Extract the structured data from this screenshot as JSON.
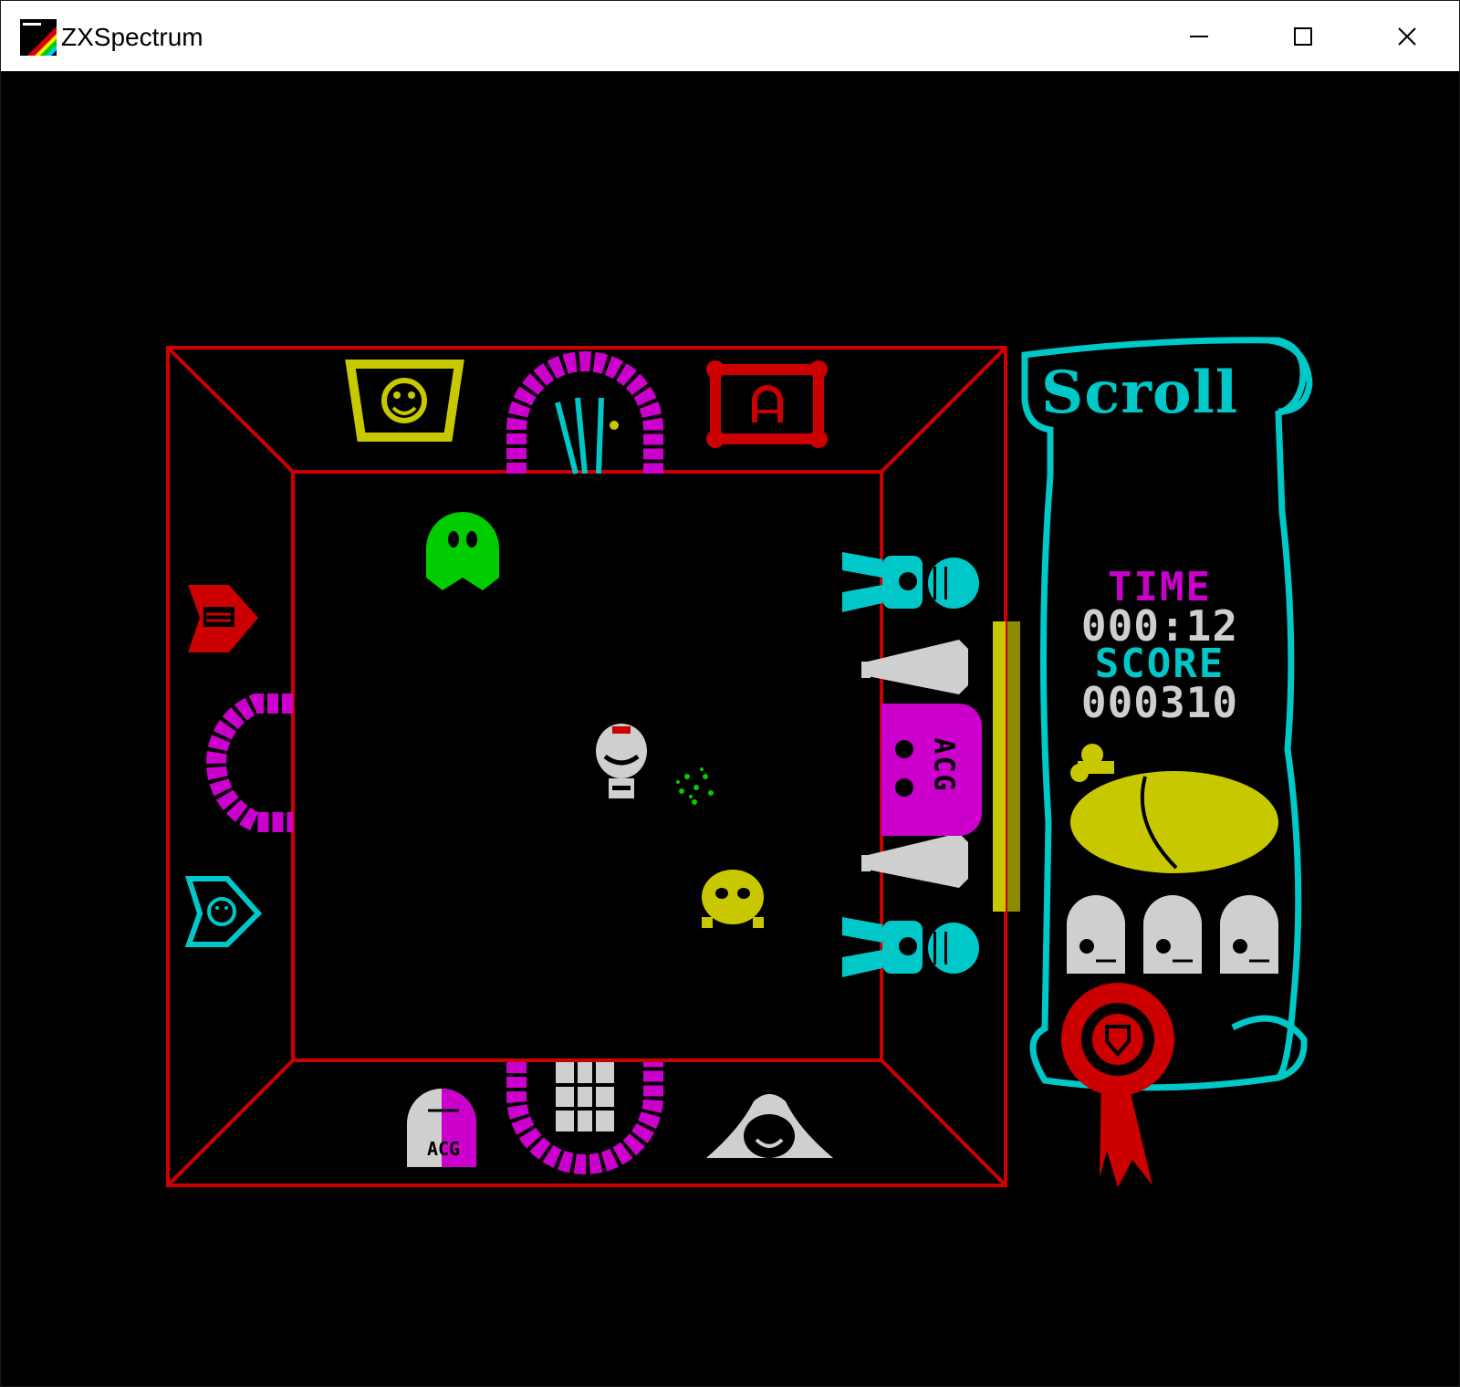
{
  "window": {
    "title": "ZXSpectrum",
    "controls": {
      "minimize": "minimize-icon",
      "maximize": "maximize-icon",
      "close": "close-icon"
    }
  },
  "hud": {
    "scroll_title": "Scroll",
    "time_label": "TIME",
    "time_value": "000:12",
    "score_label": "SCORE",
    "score_value": "000310",
    "lives_remaining": 3
  },
  "door_signs": {
    "left": "ACG",
    "bottom": "ACG"
  },
  "colors": {
    "room": "#cc0000",
    "magenta": "#cc00cc",
    "cyan": "#00c8c8",
    "yellow": "#c8c800",
    "green": "#00cc00",
    "white": "#cfcfcf",
    "background": "#000000"
  }
}
